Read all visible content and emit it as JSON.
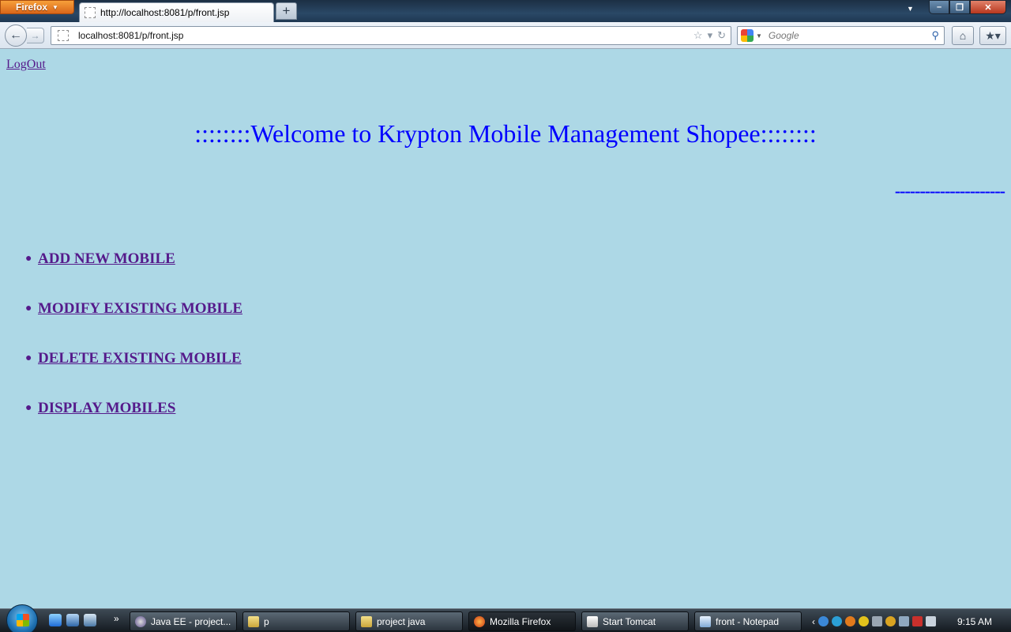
{
  "browser": {
    "app_button": "Firefox",
    "tab_title": "http://localhost:8081/p/front.jsp",
    "url": "localhost:8081/p/front.jsp",
    "search_placeholder": "Google"
  },
  "page": {
    "logout": "LogOut",
    "welcome": "::::::::Welcome to Krypton Mobile Management Shopee::::::::",
    "dashes": "----------------------",
    "menu": [
      {
        "label": "ADD NEW MOBILE"
      },
      {
        "label": "MODIFY EXISTING MOBILE"
      },
      {
        "label": "DELETE EXISTING MOBILE"
      },
      {
        "label": "DISPLAY MOBILES"
      }
    ],
    "colors": {
      "background": "#add8e6",
      "heading": "#0000ff",
      "visited_link": "#551a8b"
    }
  },
  "taskbar": {
    "items": [
      {
        "label": "Java EE - project...",
        "icon": "eclipse-icon"
      },
      {
        "label": "p",
        "icon": "folder-icon"
      },
      {
        "label": "project java",
        "icon": "folder-icon"
      },
      {
        "label": "Mozilla Firefox",
        "icon": "firefox-icon"
      },
      {
        "label": "Start Tomcat",
        "icon": "tomcat-icon"
      },
      {
        "label": "front - Notepad",
        "icon": "notepad-icon"
      }
    ],
    "clock": "9:15 AM"
  }
}
